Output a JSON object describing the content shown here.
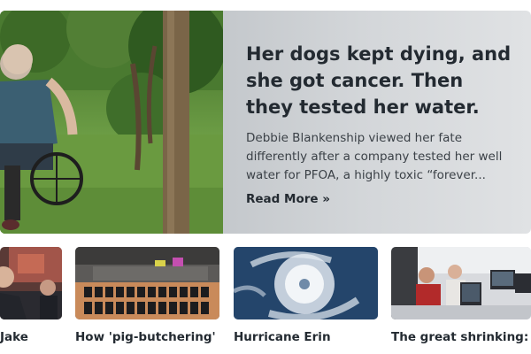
{
  "hero": {
    "title": "Her dogs kept dying, and she got cancer. Then they tested her water.",
    "description": "Debbie Blankenship viewed her fate differently after a company tested her well water for PFOA, a highly toxic “forever...",
    "read_more": "Read More »"
  },
  "cards": [
    {
      "title_line1": "Jake",
      "title_line2": "..."
    },
    {
      "title_line1": "How 'pig-butchering'",
      "title_line2": "..."
    },
    {
      "title_line1": "Hurricane Erin",
      "title_line2": "..."
    },
    {
      "title_line1": "The great shrinking:",
      "title_line2": "..."
    }
  ]
}
